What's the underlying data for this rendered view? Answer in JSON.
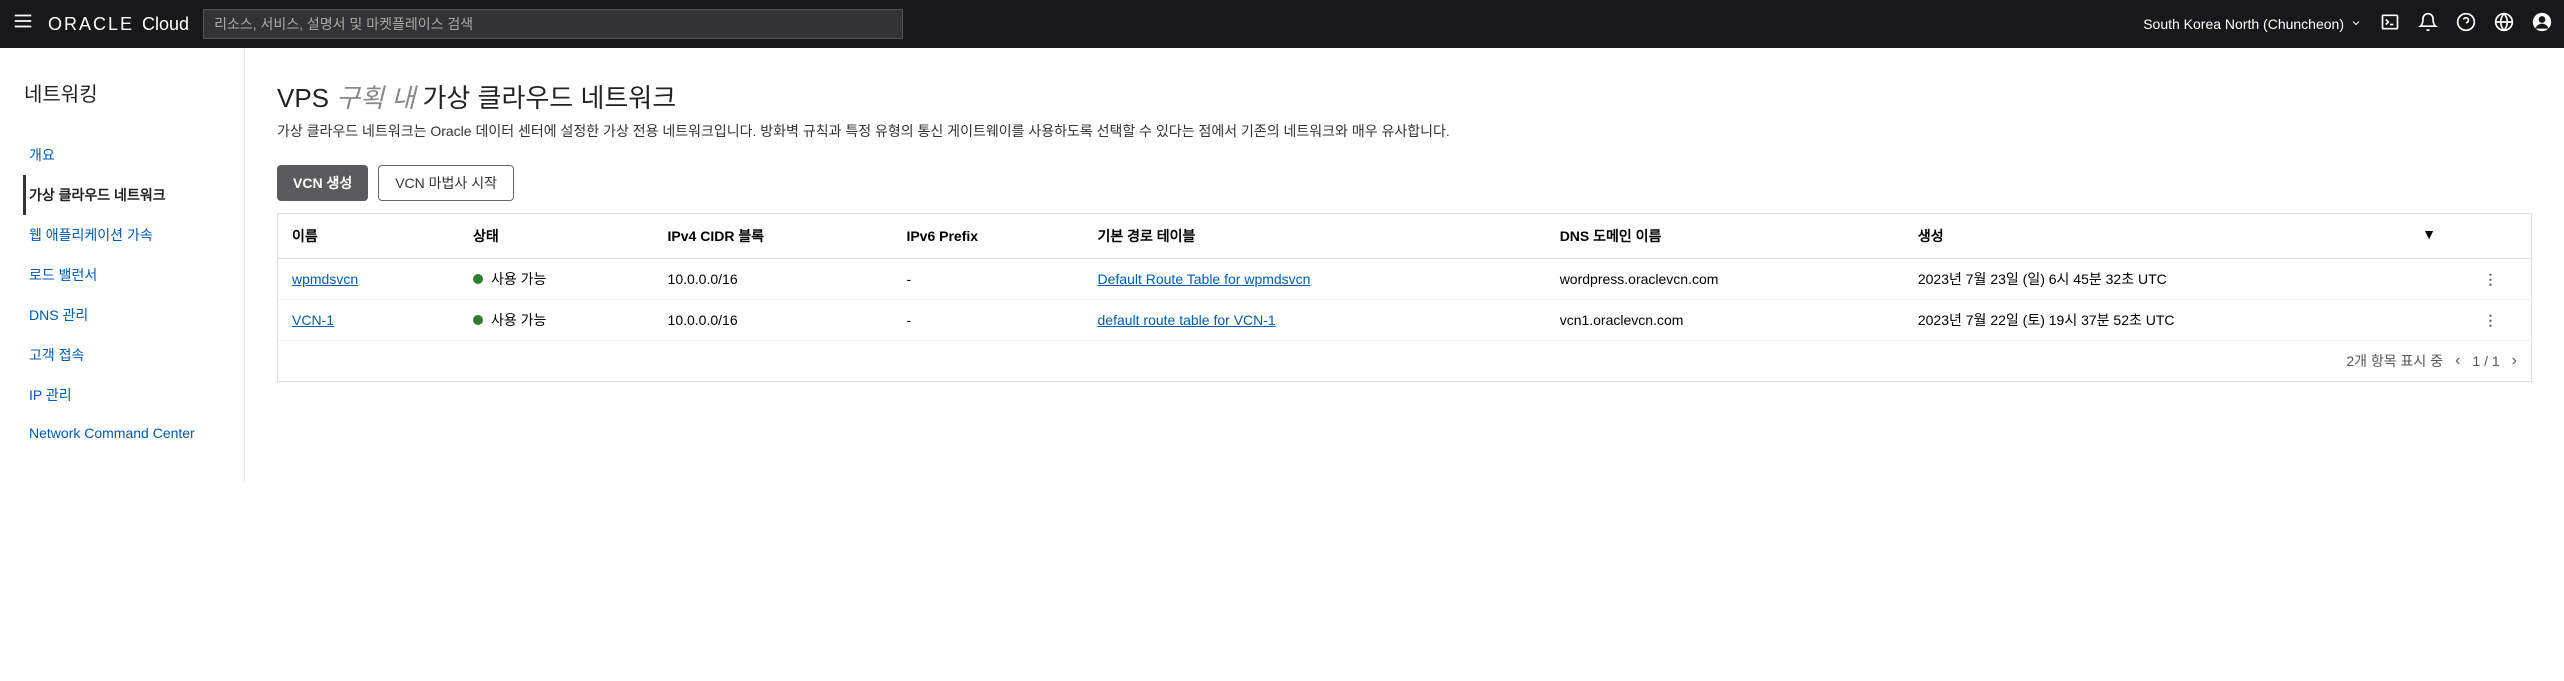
{
  "header": {
    "logo_brand": "ORACLE",
    "logo_product": "Cloud",
    "search_placeholder": "리소스, 서비스, 설명서 및 마켓플레이스 검색",
    "region": "South Korea North (Chuncheon)"
  },
  "sidebar": {
    "title": "네트워킹",
    "items": [
      {
        "label": "개요",
        "active": false
      },
      {
        "label": "가상 클라우드 네트워크",
        "active": true
      },
      {
        "label": "웹 애플리케이션 가속",
        "active": false
      },
      {
        "label": "로드 밸런서",
        "active": false
      },
      {
        "label": "DNS 관리",
        "active": false
      },
      {
        "label": "고객 접속",
        "active": false
      },
      {
        "label": "IP 관리",
        "active": false
      },
      {
        "label": "Network Command Center",
        "active": false
      }
    ]
  },
  "page": {
    "title_prefix": "VPS",
    "title_compartment": "구획 내",
    "title_suffix": "가상 클라우드 네트워크",
    "description": "가상 클라우드 네트워크는 Oracle 데이터 센터에 설정한 가상 전용 네트워크입니다. 방화벽 규칙과 특정 유형의 통신 게이트웨이를 사용하도록 선택할 수 있다는 점에서 기존의 네트워크와 매우 유사합니다."
  },
  "actions": {
    "create_vcn": "VCN 생성",
    "start_wizard": "VCN 마법사 시작"
  },
  "table": {
    "columns": {
      "name": "이름",
      "status": "상태",
      "ipv4_cidr": "IPv4 CIDR 블록",
      "ipv6_prefix": "IPv6 Prefix",
      "default_route_table": "기본 경로 테이블",
      "dns_domain": "DNS 도메인 이름",
      "created": "생성"
    },
    "rows": [
      {
        "name": "wpmdsvcn",
        "status": "사용 가능",
        "ipv4_cidr": "10.0.0.0/16",
        "ipv6_prefix": "-",
        "default_route_table": "Default Route Table for wpmdsvcn",
        "dns_domain": "wordpress.oraclevcn.com",
        "created": "2023년 7월 23일 (일) 6시 45분 32초 UTC"
      },
      {
        "name": "VCN-1",
        "status": "사용 가능",
        "ipv4_cidr": "10.0.0.0/16",
        "ipv6_prefix": "-",
        "default_route_table": "default route table for VCN-1",
        "dns_domain": "vcn1.oraclevcn.com",
        "created": "2023년 7월 22일 (토) 19시 37분 52초 UTC"
      }
    ]
  },
  "pagination": {
    "summary": "2개 항목 표시 중",
    "page_display": "1 / 1"
  }
}
